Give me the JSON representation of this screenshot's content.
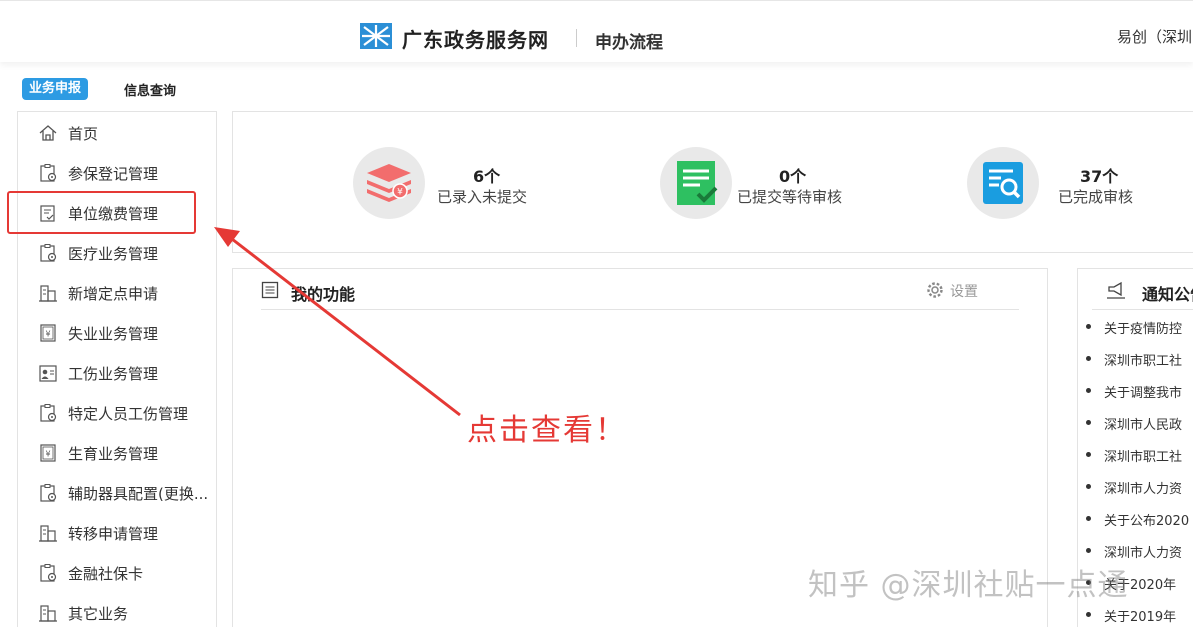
{
  "header": {
    "site_title": "广东政务服务网",
    "flow_title": "申办流程",
    "user_name": "易创（深圳"
  },
  "tabs": [
    {
      "label": "业务申报",
      "active": true
    },
    {
      "label": "信息查询",
      "active": false
    }
  ],
  "sidebar": {
    "items": [
      {
        "label": "首页",
        "icon": "home-icon"
      },
      {
        "label": "参保登记管理",
        "icon": "clipboard-gear-icon"
      },
      {
        "label": "单位缴费管理",
        "icon": "invoice-icon",
        "highlighted": true
      },
      {
        "label": "医疗业务管理",
        "icon": "clipboard-gear-icon"
      },
      {
        "label": "新增定点申请",
        "icon": "building-icon"
      },
      {
        "label": "失业业务管理",
        "icon": "yen-document-icon"
      },
      {
        "label": "工伤业务管理",
        "icon": "person-card-icon"
      },
      {
        "label": "特定人员工伤管理",
        "icon": "clipboard-gear-icon"
      },
      {
        "label": "生育业务管理",
        "icon": "yen-document-icon"
      },
      {
        "label": "辅助器具配置(更换...",
        "icon": "clipboard-gear-icon"
      },
      {
        "label": "转移申请管理",
        "icon": "building-icon"
      },
      {
        "label": "金融社保卡",
        "icon": "clipboard-gear-icon"
      },
      {
        "label": "其它业务",
        "icon": "building-icon"
      }
    ]
  },
  "stats": [
    {
      "count": "6个",
      "label": "已录入未提交",
      "icon": "stack-icon",
      "color": "#f26d6d"
    },
    {
      "count": "0个",
      "label": "已提交等待审核",
      "icon": "checklist-icon",
      "color": "#2ec061"
    },
    {
      "count": "37个",
      "label": "已完成审核",
      "icon": "search-document-icon",
      "color": "#1a9de0"
    }
  ],
  "functions": {
    "title": "我的功能",
    "settings_label": "设置"
  },
  "notice": {
    "title": "通知公告",
    "items": [
      "关于疫情防控",
      "深圳市职工社",
      "关于调整我市",
      "深圳市人民政",
      "深圳市职工社",
      "深圳市人力资",
      "关于公布2020",
      "深圳市人力资",
      "关于2020年",
      "关于2019年"
    ]
  },
  "annotation": {
    "text": "点击查看！",
    "color": "#e53935"
  },
  "watermark": "知乎 @深圳社贴一点通",
  "colors": {
    "accent": "#2d9be3",
    "highlight": "#e53935"
  }
}
